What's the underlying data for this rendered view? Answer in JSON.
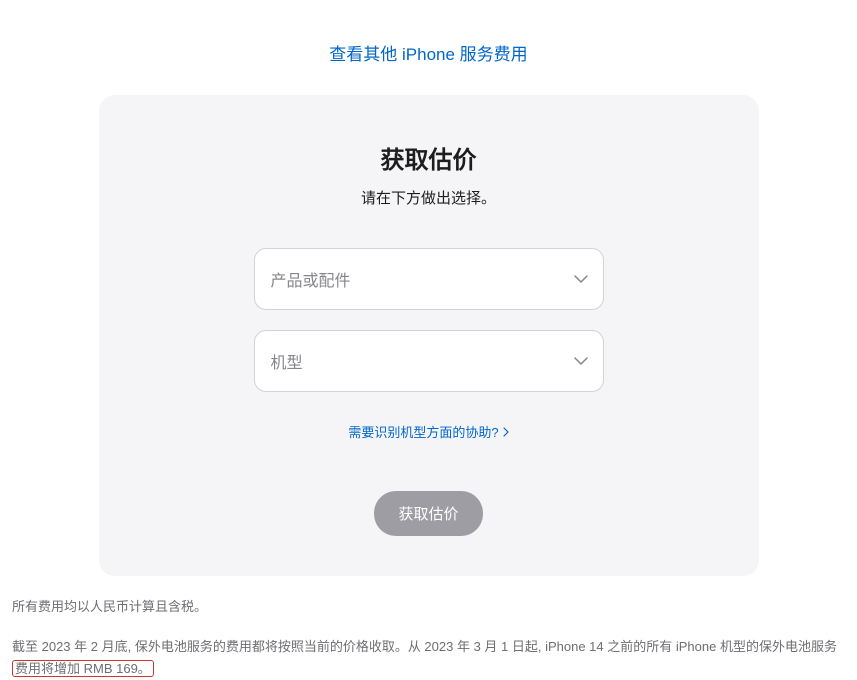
{
  "top_link": {
    "label": "查看其他 iPhone 服务费用"
  },
  "card": {
    "title": "获取估价",
    "subtitle": "请在下方做出选择。",
    "select_product_placeholder": "产品或配件",
    "select_model_placeholder": "机型",
    "help_link_label": "需要识别机型方面的协助?",
    "submit_label": "获取估价"
  },
  "footer": {
    "line1": "所有费用均以人民币计算且含税。",
    "line2_prefix": "截至 2023 年 2 月底, 保外电池服务的费用都将按照当前的价格收取。从 2023 年 3 月 1 日起, iPhone 14 之前的所有 iPhone 机型的保外电池服务",
    "line2_highlight": "费用将增加 RMB 169。"
  }
}
